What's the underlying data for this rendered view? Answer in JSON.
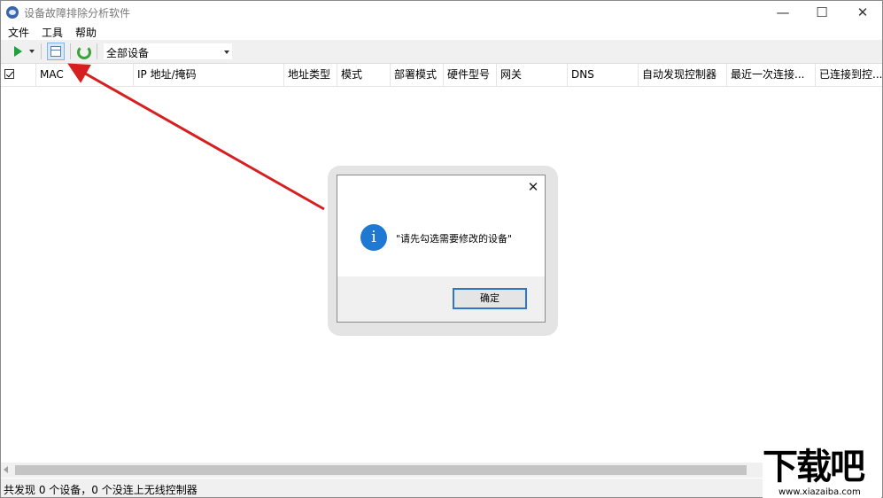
{
  "window": {
    "title": "设备故障排除分析软件",
    "minimize_glyph": "—",
    "maximize_glyph": "☐",
    "close_glyph": "✕"
  },
  "menu": [
    "文件",
    "工具",
    "帮助"
  ],
  "toolbar": {
    "device_filter": "全部设备",
    "icons": [
      "play-icon",
      "dropdown-caret-icon",
      "device-table-icon",
      "refresh-icon"
    ],
    "play_color": "#1ea03a",
    "refresh_color": "#3aa33a"
  },
  "table": {
    "columns": [
      "MAC",
      "IP 地址/掩码",
      "地址类型",
      "模式",
      "部署模式",
      "硬件型号",
      "网关",
      "DNS",
      "自动发现控制器",
      "最近一次连接...",
      "已连接到控..."
    ]
  },
  "status": "共发现 0 个设备，0 个没连上无线控制器",
  "dialog": {
    "message": "\"请先勾选需要修改的设备\"",
    "ok_label": "确定",
    "close_glyph": "✕",
    "info_glyph": "i",
    "info_color": "#1f78d1"
  },
  "annotation": {
    "arrow_color": "#d62020"
  },
  "watermark": {
    "main": "下载吧",
    "sub": "www.xiazaiba.com"
  }
}
